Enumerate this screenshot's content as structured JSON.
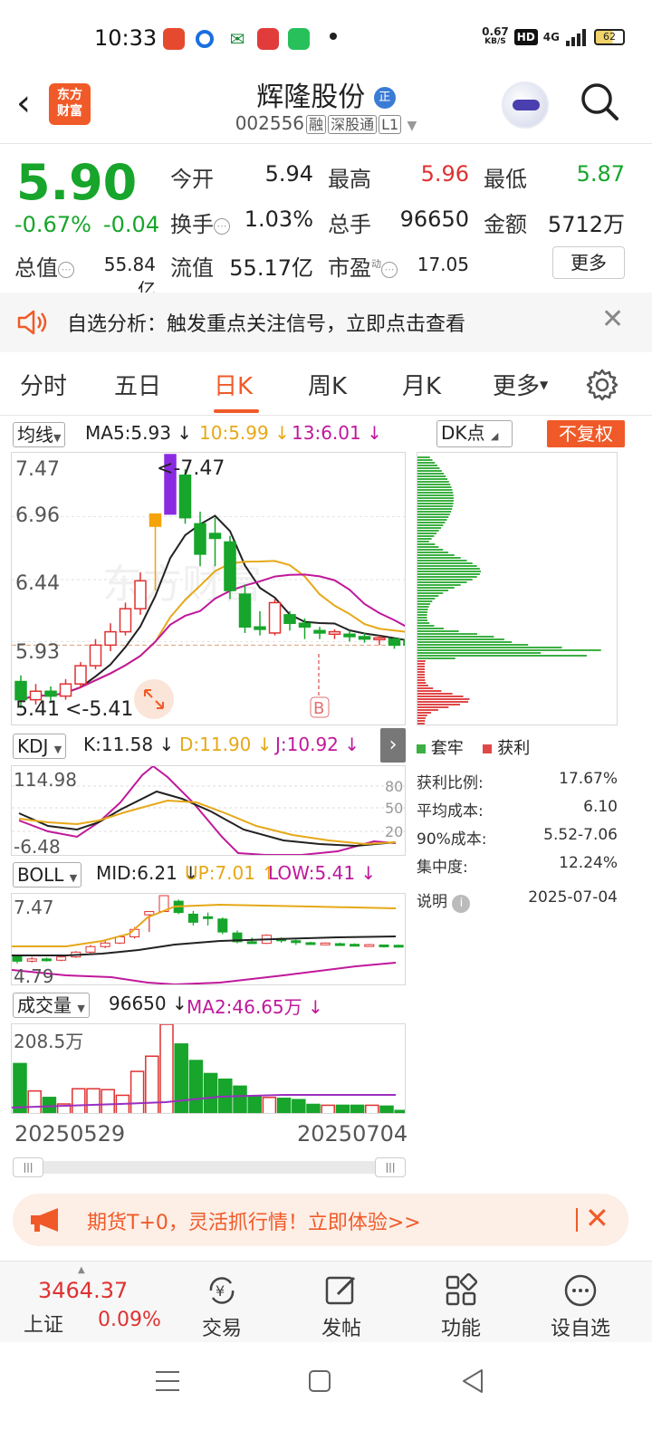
{
  "status_bar": {
    "time": "10:33",
    "net_speed": "0.67",
    "net_unit": "KB/S",
    "hd": "HD",
    "signal": "4G",
    "battery": "62"
  },
  "header": {
    "back": "‹",
    "logo_line1": "东方",
    "logo_line2": "财富",
    "stock_name": "辉隆股份",
    "name_badge": "正",
    "stock_code": "002556",
    "badge_rong": "融",
    "badge_sgt": "深股通",
    "badge_l1": "L1"
  },
  "quote": {
    "price": "5.90",
    "change_pct": "-0.67%",
    "change_amt": "-0.04",
    "open_label": "今开",
    "open": "5.94",
    "high_label": "最高",
    "high": "5.96",
    "low_label": "最低",
    "low": "5.87",
    "turnover_label": "换手",
    "turnover": "1.03%",
    "volume_label": "总手",
    "volume": "96650",
    "amount_label": "金额",
    "amount": "5712万",
    "mktcap_label": "总值",
    "mktcap": "55.84亿",
    "float_label": "流值",
    "float_cap": "55.17亿",
    "pe_label": "市盈",
    "pe_sup": "动",
    "pe": "17.05",
    "more_button": "更多"
  },
  "alert": {
    "text": "自选分析：触发重点关注信号，立即点击查看",
    "close": "✕"
  },
  "tabs": [
    "分时",
    "五日",
    "日K",
    "周K",
    "月K",
    "更多"
  ],
  "active_tab": "日K",
  "ma_bar": {
    "selector": "均线",
    "ma5": "MA5:5.93",
    "ma10": "10:5.99",
    "ma13": "13:6.01",
    "arrow": "↓"
  },
  "dk": {
    "button": "DK点",
    "fuquan": "不复权",
    "legend_trapped": "套牢",
    "legend_profit": "获利"
  },
  "kline": {
    "y_labels": [
      "7.47",
      "6.96",
      "6.44",
      "5.93",
      "5.41"
    ],
    "max_marker": "<-7.47",
    "min_marker": "<-5.41",
    "b_marker": "B",
    "watermark": "东方财富"
  },
  "kdj": {
    "selector": "KDJ",
    "k": "K:11.58",
    "d": "D:11.90",
    "j": "J:10.92",
    "y_top": "114.98",
    "y_bottom": "-6.48",
    "levels": [
      "80",
      "50",
      "20"
    ]
  },
  "boll": {
    "selector": "BOLL",
    "mid": "MID:6.21",
    "up": "UP:7.01",
    "low": "LOW:5.41",
    "y_top": "7.47",
    "y_bottom": "4.79"
  },
  "vol": {
    "selector": "成交量",
    "value": "96650",
    "ma2": "MA2:46.65万",
    "y_top": "208.5万"
  },
  "dates": {
    "start": "20250529",
    "end": "20250704"
  },
  "chip_stats": [
    {
      "label": "获利比例:",
      "value": "17.67%"
    },
    {
      "label": "平均成本:",
      "value": "6.10"
    },
    {
      "label": "90%成本:",
      "value": "5.52-7.06"
    },
    {
      "label": "集中度:",
      "value": "12.24%"
    }
  ],
  "chip_note": {
    "label": "说明",
    "date": "2025-07-04"
  },
  "promo": {
    "text": "期货T+0，灵活抓行情！立即体验>>",
    "close": "✕"
  },
  "bottom_nav": {
    "index_value": "3464.37",
    "index_name": "上证",
    "index_change": "0.09%",
    "items": [
      "交易",
      "发帖",
      "功能",
      "设自选"
    ]
  },
  "colors": {
    "brand": "#f05a28",
    "up": "#e03131",
    "down": "#17a52b",
    "ma10": "#e6a817",
    "ma13": "#c0189b"
  },
  "candles": [
    {
      "o": 5.6,
      "h": 5.65,
      "l": 5.38,
      "c": 5.45
    },
    {
      "o": 5.45,
      "h": 5.58,
      "l": 5.41,
      "c": 5.52
    },
    {
      "o": 5.52,
      "h": 5.56,
      "l": 5.44,
      "c": 5.48
    },
    {
      "o": 5.48,
      "h": 5.62,
      "l": 5.45,
      "c": 5.58
    },
    {
      "o": 5.58,
      "h": 5.76,
      "l": 5.55,
      "c": 5.73
    },
    {
      "o": 5.73,
      "h": 5.95,
      "l": 5.7,
      "c": 5.9
    },
    {
      "o": 5.9,
      "h": 6.08,
      "l": 5.85,
      "c": 6.01
    },
    {
      "o": 6.01,
      "h": 6.25,
      "l": 5.98,
      "c": 6.2
    },
    {
      "o": 6.2,
      "h": 6.5,
      "l": 6.15,
      "c": 6.43
    },
    {
      "o": 6.88,
      "h": 6.88,
      "l": 6.35,
      "c": 6.98
    },
    {
      "o": 6.98,
      "h": 7.47,
      "l": 6.98,
      "c": 7.47
    },
    {
      "o": 7.3,
      "h": 7.35,
      "l": 6.9,
      "c": 6.95
    },
    {
      "o": 6.9,
      "h": 7.0,
      "l": 6.55,
      "c": 6.65
    },
    {
      "o": 6.82,
      "h": 6.95,
      "l": 6.55,
      "c": 6.78
    },
    {
      "o": 6.75,
      "h": 6.8,
      "l": 6.28,
      "c": 6.35
    },
    {
      "o": 6.32,
      "h": 6.4,
      "l": 6.0,
      "c": 6.05
    },
    {
      "o": 6.05,
      "h": 6.18,
      "l": 5.98,
      "c": 6.03
    },
    {
      "o": 6.0,
      "h": 6.28,
      "l": 5.98,
      "c": 6.25
    },
    {
      "o": 6.15,
      "h": 6.18,
      "l": 6.02,
      "c": 6.08
    },
    {
      "o": 6.08,
      "h": 6.12,
      "l": 5.95,
      "c": 6.05
    },
    {
      "o": 6.02,
      "h": 6.05,
      "l": 5.95,
      "c": 6.0
    },
    {
      "o": 5.99,
      "h": 6.03,
      "l": 5.95,
      "c": 6.01
    },
    {
      "o": 5.99,
      "h": 6.02,
      "l": 5.93,
      "c": 5.97
    },
    {
      "o": 5.97,
      "h": 6.0,
      "l": 5.92,
      "c": 5.95
    },
    {
      "o": 5.95,
      "h": 5.98,
      "l": 5.9,
      "c": 5.96
    },
    {
      "o": 5.95,
      "h": 5.96,
      "l": 5.87,
      "c": 5.9
    },
    {
      "o": 5.94,
      "h": 5.96,
      "l": 5.87,
      "c": 5.9
    }
  ],
  "volumes": [
    118,
    55,
    40,
    25,
    60,
    60,
    58,
    45,
    100,
    135,
    208.5,
    163,
    125,
    95,
    82,
    66,
    42,
    40,
    38,
    35,
    24,
    22,
    22,
    22,
    22,
    20,
    10
  ]
}
